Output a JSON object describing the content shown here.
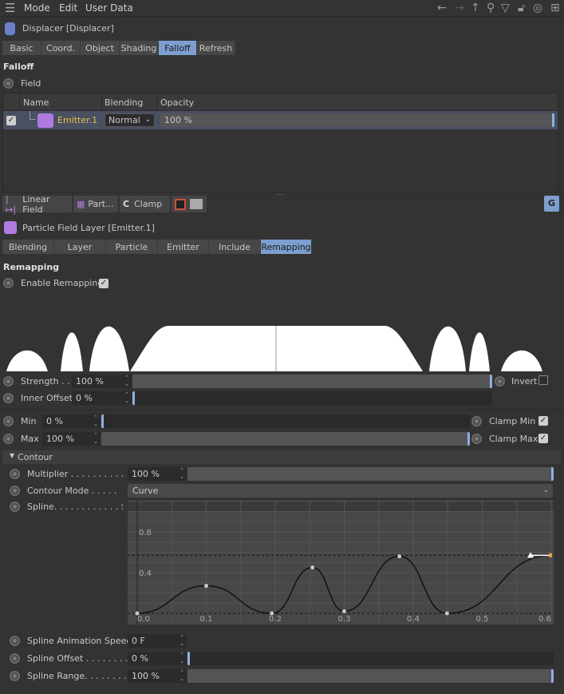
{
  "menu": {
    "items": [
      "Mode",
      "Edit",
      "User Data"
    ],
    "icons": [
      "hamburger-icon",
      "back-arrow-icon",
      "forward-arrow-icon",
      "up-arrow-icon",
      "search-icon",
      "filter-icon",
      "lock-icon",
      "target-icon",
      "new-panel-icon"
    ]
  },
  "object": {
    "title": "Displacer [Displacer]",
    "tabs": [
      "Basic",
      "Coord.",
      "Object",
      "Shading",
      "Falloff",
      "Refresh"
    ],
    "active_tab": "Falloff"
  },
  "falloff": {
    "header": "Falloff",
    "field_label": "Field",
    "table": {
      "columns": [
        "Name",
        "Blending",
        "Opacity"
      ],
      "rows": [
        {
          "checked": true,
          "name": "Emitter.1",
          "blending": "Normal",
          "opacity": "100 %"
        }
      ]
    },
    "toolbar": [
      "Linear Field",
      "Part...",
      "Clamp"
    ]
  },
  "layer": {
    "title": "Particle Field Layer [Emitter.1]",
    "tabs": [
      "Blending",
      "Layer",
      "Particle",
      "Emitter",
      "Include",
      "Remapping"
    ],
    "active_tab": "Remapping"
  },
  "remapping": {
    "header": "Remapping",
    "enable_label": "Enable Remapping",
    "enabled": true,
    "strength": {
      "label": "Strength . .",
      "value": "100 %",
      "fraction": 1.0
    },
    "invert": {
      "label": "Invert",
      "checked": false
    },
    "inner_offset": {
      "label": "Inner Offset",
      "value": "0 %",
      "fraction": 0.0
    },
    "min": {
      "label": "Min",
      "value": "0 %",
      "fraction": 0.0
    },
    "max": {
      "label": "Max",
      "value": "100 %",
      "fraction": 1.0
    },
    "clamp_min": {
      "label": "Clamp Min",
      "checked": true
    },
    "clamp_max": {
      "label": "Clamp Max",
      "checked": true
    }
  },
  "contour": {
    "header": "Contour",
    "multiplier": {
      "label": "Multiplier . . . . . . . . . .",
      "value": "100 %",
      "fraction": 1.0
    },
    "mode": {
      "label": "Contour Mode . . . . .",
      "value": "Curve"
    },
    "spline_label": "Spline. . . . . . . . . . . . .",
    "anim_speed": {
      "label": "Spline Animation Speed",
      "value": "0 F"
    },
    "offset": {
      "label": "Spline Offset . . . . . . . .",
      "value": "0 %",
      "fraction": 0.0
    },
    "range": {
      "label": "Spline Range. . . . . . . .",
      "value": "100 %",
      "fraction": 1.0
    }
  },
  "chart_data": {
    "type": "line",
    "xlim": [
      0,
      0.6
    ],
    "ylim": [
      0,
      1
    ],
    "x_ticks": [
      "0.0",
      "0.1",
      "0.2",
      "0.3",
      "0.4",
      "0.5",
      "0.6"
    ],
    "y_ticks": [
      "0.4",
      "0.8"
    ],
    "points": [
      [
        0,
        0
      ],
      [
        0.1,
        0.27
      ],
      [
        0.195,
        0
      ],
      [
        0.254,
        0.45
      ],
      [
        0.3,
        0.02
      ],
      [
        0.38,
        0.56
      ],
      [
        0.449,
        0
      ],
      [
        0.6,
        0.57
      ]
    ],
    "grid": true,
    "color": "#111111"
  },
  "colors": {
    "accent": "#7d9fd0",
    "emitter_name": "#e8c04a"
  }
}
